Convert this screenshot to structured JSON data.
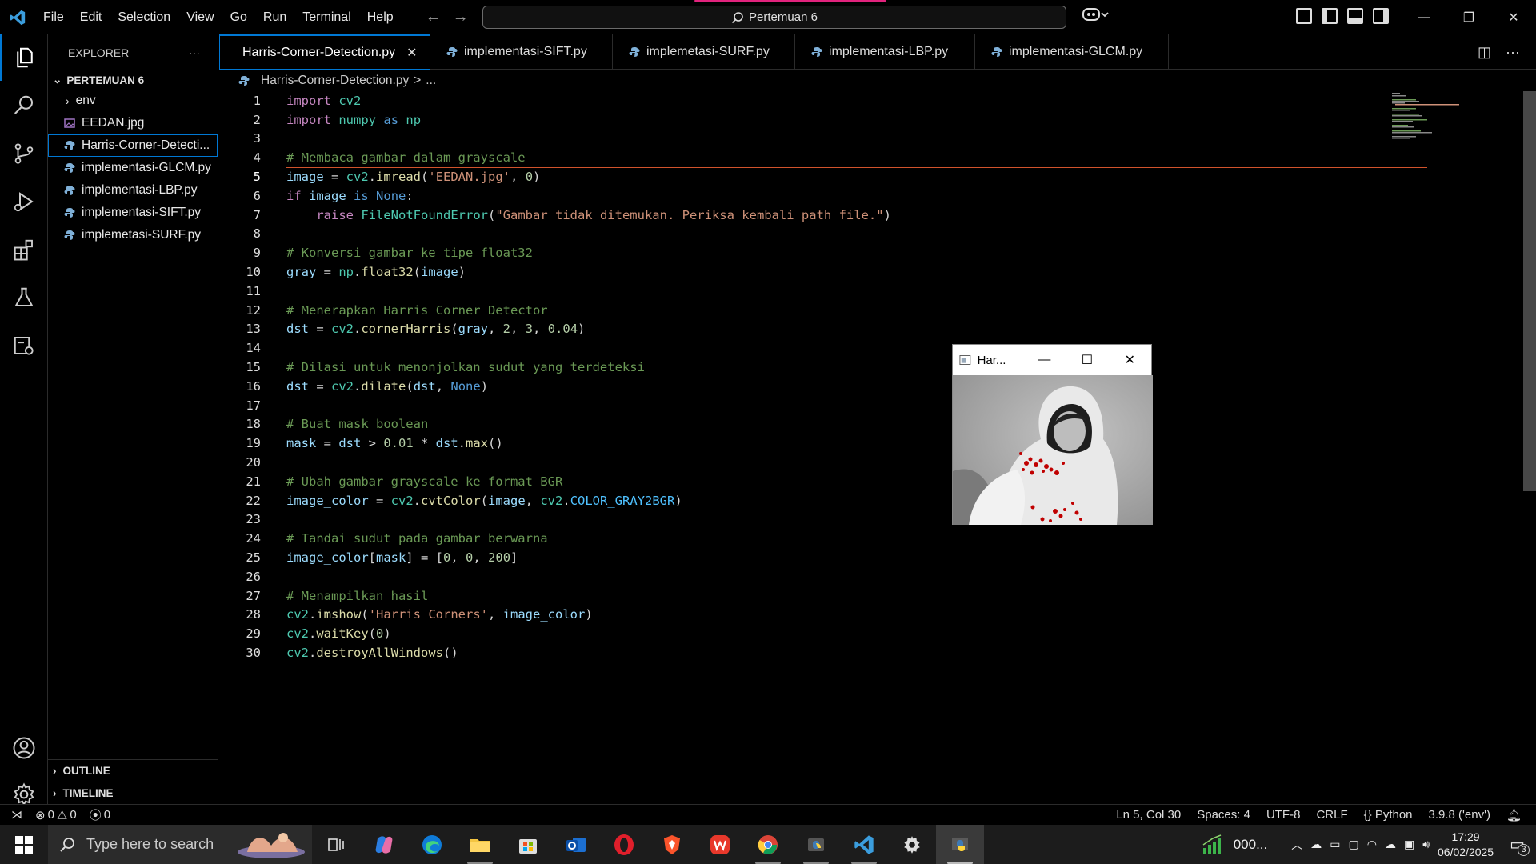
{
  "titlebar": {
    "menu": [
      "File",
      "Edit",
      "Selection",
      "View",
      "Go",
      "Run",
      "Terminal",
      "Help"
    ],
    "search_text": "Pertemuan 6"
  },
  "explorer": {
    "header": "EXPLORER",
    "more": "···",
    "folder": "PERTEMUAN 6",
    "items": [
      "env",
      "EEDAN.jpg",
      "Harris-Corner-Detecti...",
      "implementasi-GLCM.py",
      "implementasi-LBP.py",
      "implementasi-SIFT.py",
      "implemetasi-SURF.py"
    ],
    "outline": "OUTLINE",
    "timeline": "TIMELINE"
  },
  "tabs": [
    "Harris-Corner-Detection.py",
    "implementasi-SIFT.py",
    "implemetasi-SURF.py",
    "implementasi-LBP.py",
    "implementasi-GLCM.py"
  ],
  "breadcrumb": {
    "file": "Harris-Corner-Detection.py",
    "sep": ">",
    "rest": "..."
  },
  "code_lines": [
    "import cv2",
    "import numpy as np",
    "",
    "# Membaca gambar dalam grayscale",
    "image = cv2.imread('EEDAN.jpg', 0)",
    "if image is None:",
    "    raise FileNotFoundError(\"Gambar tidak ditemukan. Periksa kembali path file.\")",
    "",
    "# Konversi gambar ke tipe float32",
    "gray = np.float32(image)",
    "",
    "# Menerapkan Harris Corner Detector",
    "dst = cv2.cornerHarris(gray, 2, 3, 0.04)",
    "",
    "# Dilasi untuk menonjolkan sudut yang terdeteksi",
    "dst = cv2.dilate(dst, None)",
    "",
    "# Buat mask boolean",
    "mask = dst > 0.01 * dst.max()",
    "",
    "# Ubah gambar grayscale ke format BGR",
    "image_color = cv2.cvtColor(image, cv2.COLOR_GRAY2BGR)",
    "",
    "# Tandai sudut pada gambar berwarna",
    "image_color[mask] = [0, 0, 200]",
    "",
    "# Menampilkan hasil",
    "cv2.imshow('Harris Corners', image_color)",
    "cv2.waitKey(0)",
    "cv2.destroyAllWindows()"
  ],
  "cv_window": {
    "title": "Har...",
    "minimize": "—",
    "maximize": "☐",
    "close": "✕"
  },
  "statusbar": {
    "errors": "0",
    "warnings": "0",
    "ports": "0",
    "position": "Ln 5, Col 30",
    "spaces": "Spaces: 4",
    "encoding": "UTF-8",
    "eol": "CRLF",
    "language": "Python",
    "interpreter": "3.9.8 ('env')"
  },
  "taskbar": {
    "search_placeholder": "Type here to search",
    "tray_label": "000...",
    "time": "17:29",
    "date": "06/02/2025",
    "notifications": "3"
  },
  "colors": {
    "accent": "#0078d4",
    "current_line": "#d1532c",
    "corner_marks": "#c00000"
  }
}
